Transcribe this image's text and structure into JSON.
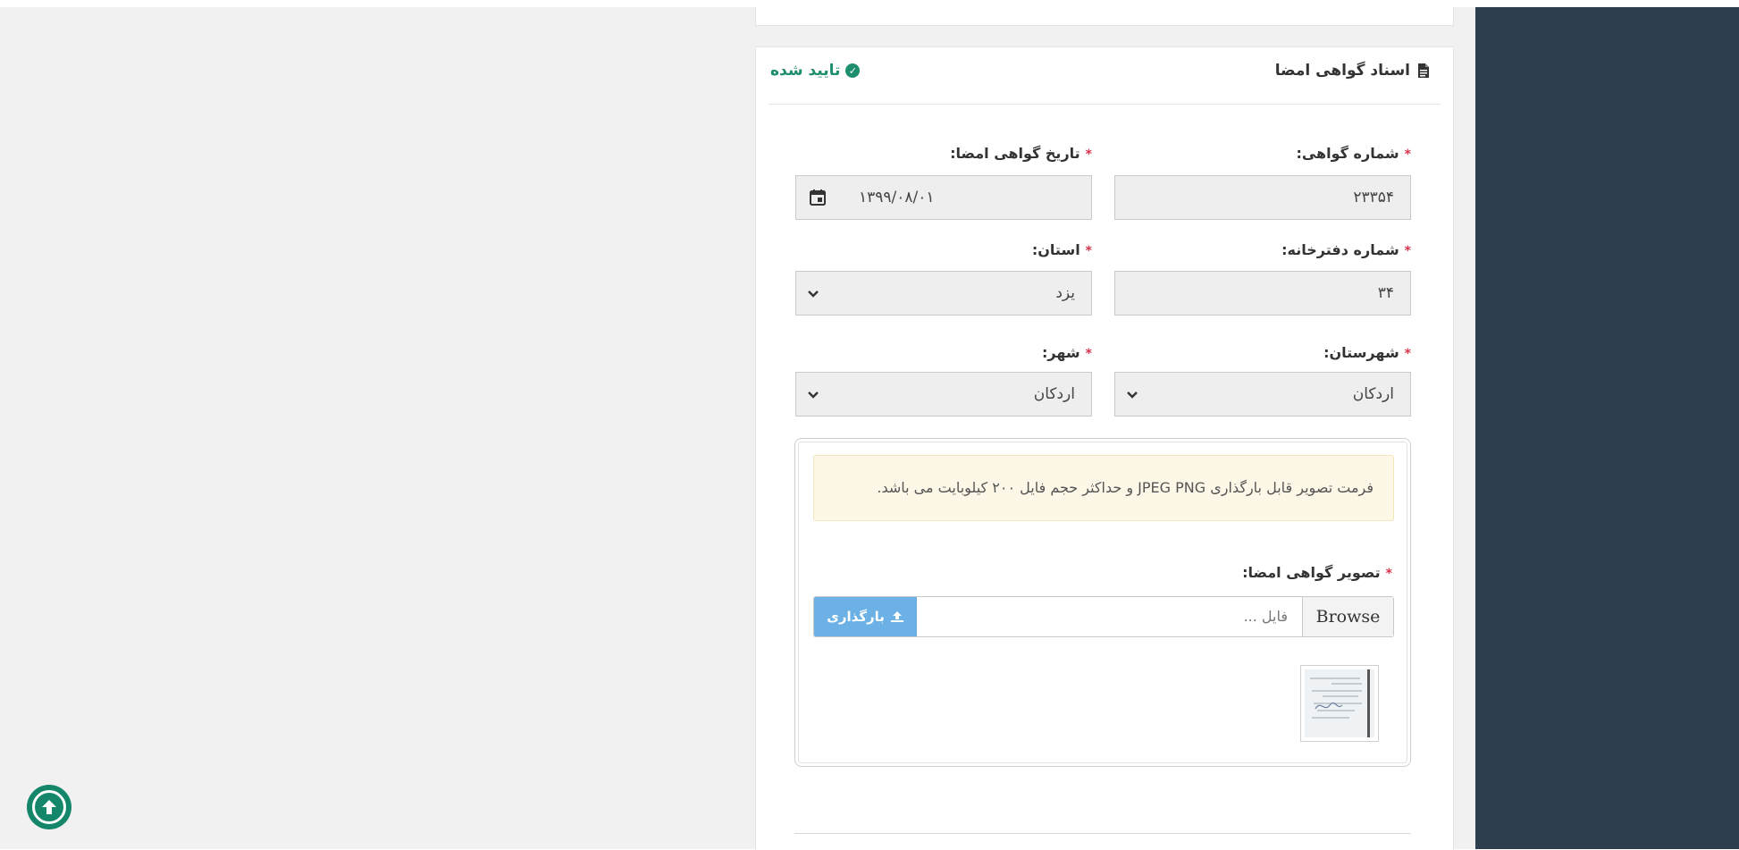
{
  "card": {
    "title": "اسناد گواهی امضا",
    "status": "تایید شده"
  },
  "fields": {
    "certificate_number": {
      "label": "شماره گواهی:",
      "value": "۲۳۳۵۴"
    },
    "certificate_date": {
      "label": "تاریخ گواهی امضا:",
      "value": "۱۳۹۹/۰۸/۰۱"
    },
    "office_number": {
      "label": "شماره دفترخانه:",
      "value": "۳۴"
    },
    "province": {
      "label": "استان:",
      "value": "یزد"
    },
    "county": {
      "label": "شهرستان:",
      "value": "اردکان"
    },
    "city": {
      "label": "شهر:",
      "value": "اردکان"
    }
  },
  "required_mark": "*",
  "upload": {
    "notice": "فرمت تصویر قابل بارگذاری JPEG PNG و حداکثر حجم فایل ۲۰۰ کیلوبایت می باشد.",
    "label": "تصویر گواهی امضا:",
    "placeholder": "فایل ...",
    "browse_label": "Browse",
    "upload_label": "بارگذاری"
  },
  "colors": {
    "side_panel": "#2d3e4f",
    "status_green": "#1e8f6e",
    "required_red": "#d9334a",
    "upload_button": "#6bb1e6",
    "notice_bg": "#fcf7e6",
    "scroll_top": "#14866a"
  },
  "icons": {
    "card_title": "document-icon",
    "status": "check-circle-icon",
    "date": "calendar-icon",
    "select": "chevron-down-icon",
    "upload": "upload-icon",
    "scroll": "arrow-up-circle-icon"
  }
}
